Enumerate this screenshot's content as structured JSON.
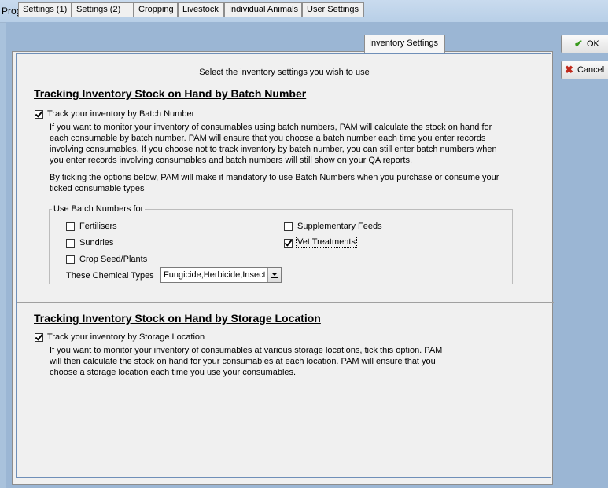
{
  "window": {
    "title": "Program Settings"
  },
  "tabs": [
    {
      "label": "Settings (1)"
    },
    {
      "label": "Settings (2)"
    },
    {
      "label": "Cropping"
    },
    {
      "label": "Livestock"
    },
    {
      "label": "Individual Animals"
    },
    {
      "label": "User Settings"
    },
    {
      "label": "Inventory Settings",
      "active": true
    }
  ],
  "buttons": {
    "ok": {
      "label": "OK",
      "icon": "checkmark-icon",
      "color": "#3a9a1e"
    },
    "cancel": {
      "label": "Cancel",
      "icon": "x-icon",
      "color": "#c0281a"
    }
  },
  "panel": {
    "subtitle": "Select the inventory settings you wish to use",
    "batch": {
      "heading": "Tracking Inventory Stock on Hand by Batch Number",
      "track_checkbox": {
        "label": "Track your inventory by Batch Number",
        "checked": true
      },
      "description_lines": [
        "If you want to monitor your inventory of consumables using batch numbers, PAM will calculate the stock on hand for",
        "each consumable by batch number. PAM will ensure that you choose a batch number each time you enter records",
        "involving consumables. If you choose not to track inventory by batch number, you can still enter batch numbers when",
        "you enter records involving consumables and batch numbers will still show on your QA reports."
      ],
      "mandatory_lines": [
        "By ticking the options below, PAM will make it mandatory to use Batch Numbers when you purchase or consume your",
        "ticked consumable types"
      ],
      "group": {
        "title": "Use Batch Numbers for",
        "options": [
          {
            "label": "Fertilisers",
            "checked": false
          },
          {
            "label": "Sundries",
            "checked": false
          },
          {
            "label": "Crop Seed/Plants",
            "checked": false
          },
          {
            "label": "Supplementary Feeds",
            "checked": false
          },
          {
            "label": "Vet Treatments",
            "checked": true
          }
        ],
        "chemical_label": "These Chemical Types",
        "chemical_value": "Fungicide,Herbicide,Insect"
      }
    },
    "storage": {
      "heading": "Tracking Inventory Stock on Hand by Storage Location",
      "track_checkbox": {
        "label": "Track your inventory by Storage Location",
        "checked": true
      },
      "description_lines": [
        "If you want to monitor your inventory of consumables at various storage locations, tick this option.  PAM",
        "will then calculate the stock on hand for your consumables at each location. PAM will ensure that you",
        "choose a storage location each time you use your consumables."
      ]
    }
  }
}
